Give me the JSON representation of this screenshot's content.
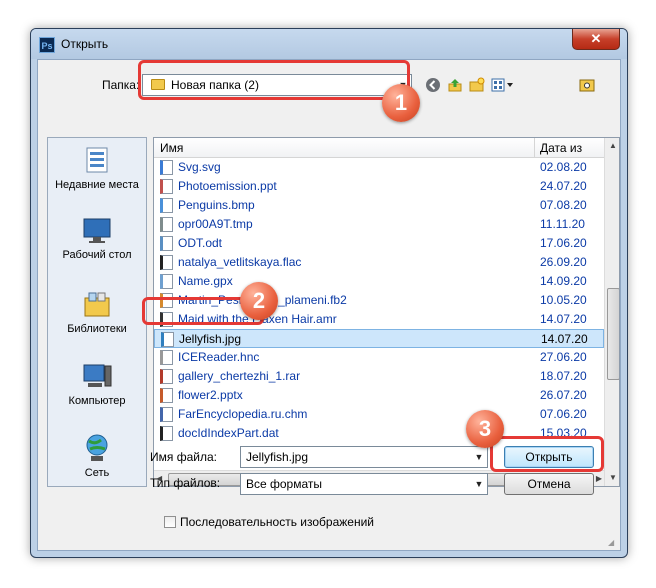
{
  "window": {
    "title": "Открыть",
    "app_icon": "Ps",
    "close_glyph": "✕"
  },
  "location": {
    "label": "Папка:",
    "folder": "Новая папка (2)"
  },
  "toolbar": {
    "back_icon": "back-arrow-icon",
    "up_icon": "up-folder-icon",
    "new_folder_icon": "new-folder-icon",
    "view_icon": "view-menu-icon"
  },
  "places": [
    {
      "label": "Недавние места",
      "icon": "recent-places-icon"
    },
    {
      "label": "Рабочий стол",
      "icon": "desktop-icon"
    },
    {
      "label": "Библиотеки",
      "icon": "libraries-icon"
    },
    {
      "label": "Компьютер",
      "icon": "computer-icon"
    },
    {
      "label": "Сеть",
      "icon": "network-icon"
    }
  ],
  "columns": {
    "name": "Имя",
    "date": "Дата из"
  },
  "files": [
    {
      "name": "Svg.svg",
      "date": "02.08.20"
    },
    {
      "name": "Photoemission.ppt",
      "date": "24.07.20"
    },
    {
      "name": "Penguins.bmp",
      "date": "07.08.20"
    },
    {
      "name": "opr00A9T.tmp",
      "date": "11.11.20"
    },
    {
      "name": "ODT.odt",
      "date": "17.06.20"
    },
    {
      "name": "natalya_vetlitskaya.flac",
      "date": "26.09.20"
    },
    {
      "name": "Name.gpx",
      "date": "14.09.20"
    },
    {
      "name": "Martin_Pesn_Ida_i_plameni.fb2",
      "date": "10.05.20"
    },
    {
      "name": "Maid with the Flaxen Hair.amr",
      "date": "14.07.20"
    },
    {
      "name": "Jellyfish.jpg",
      "date": "14.07.20"
    },
    {
      "name": "ICEReader.hnc",
      "date": "27.06.20"
    },
    {
      "name": "gallery_chertezhi_1.rar",
      "date": "18.07.20"
    },
    {
      "name": "flower2.pptx",
      "date": "26.07.20"
    },
    {
      "name": "FarEncyclopedia.ru.chm",
      "date": "07.06.20"
    },
    {
      "name": "docIdIndexPart.dat",
      "date": "15.03.20"
    }
  ],
  "filename": {
    "label": "Имя файла:",
    "value": "Jellyfish.jpg"
  },
  "filetype": {
    "label": "Тип файлов:",
    "value": "Все форматы"
  },
  "buttons": {
    "open": "Открыть",
    "cancel": "Отмена"
  },
  "sequence": {
    "label": "Последовательность изображений",
    "checked": false
  },
  "annotations": [
    "1",
    "2",
    "3"
  ],
  "colors": {
    "selection": "#cde6fb",
    "highlight": "#e53935",
    "badge": "#e9603e",
    "link_text": "#0b3aa6"
  }
}
